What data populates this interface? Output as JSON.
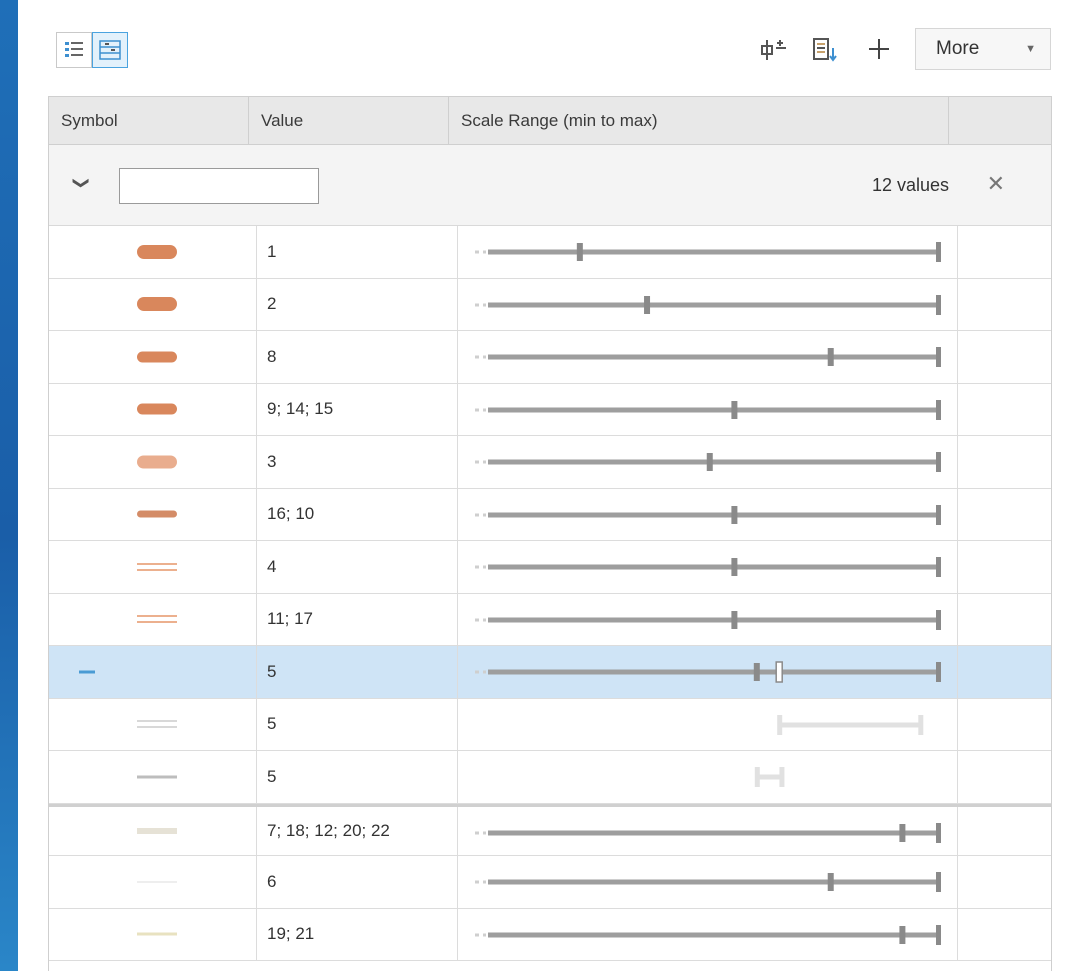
{
  "toolbar": {
    "view_list_icon": "list-view-icon",
    "view_detail_icon": "detail-view-icon",
    "add_scale_icon": "add-scale-break-icon",
    "sort_icon": "sort-values-icon",
    "add_icon": "add-icon",
    "more_label": "More"
  },
  "columns": {
    "symbol": "Symbol",
    "value": "Value",
    "scale_range": "Scale Range (min to max)"
  },
  "filter": {
    "placeholder": "",
    "count_label": "12 values"
  },
  "colors": {
    "accent": "#4a9bd4",
    "selected_row": "#cfe4f6",
    "slider": "#9e9e9e"
  },
  "rows": [
    {
      "value": "1",
      "symbol": "tall",
      "range": {
        "marker": 0.205
      }
    },
    {
      "value": "2",
      "symbol": "tall",
      "range": {
        "marker": 0.355
      }
    },
    {
      "value": "8",
      "symbol": "mid",
      "range": {
        "marker": 0.765
      }
    },
    {
      "value": "9; 14; 15",
      "symbol": "mid",
      "range": {
        "marker": 0.55
      }
    },
    {
      "value": "3",
      "symbol": "light",
      "range": {
        "marker": 0.495
      }
    },
    {
      "value": "16; 10",
      "symbol": "thin",
      "range": {
        "marker": 0.55
      }
    },
    {
      "value": "4",
      "symbol": "dbl-orange",
      "range": {
        "marker": 0.55
      }
    },
    {
      "value": "11; 17",
      "symbol": "dbl-orange",
      "range": {
        "marker": 0.55
      }
    },
    {
      "value": "5",
      "symbol": "blue",
      "selected": true,
      "range": {
        "marker": 0.6,
        "marker2": 0.65
      }
    },
    {
      "value": "5",
      "symbol": "dbl-grey",
      "range": {
        "faded": true,
        "start": 0.65,
        "end": 0.965
      }
    },
    {
      "value": "5",
      "symbol": "grey",
      "range": {
        "faded": true,
        "start": 0.6,
        "end": 0.655
      }
    },
    {
      "value": "7; 18; 12; 20; 22",
      "symbol": "beige",
      "groupbreak": true,
      "range": {
        "marker": 0.925
      }
    },
    {
      "value": "6",
      "symbol": "pale",
      "range": {
        "marker": 0.765
      }
    },
    {
      "value": "19; 21",
      "symbol": "cream",
      "range": {
        "marker": 0.925
      }
    }
  ]
}
